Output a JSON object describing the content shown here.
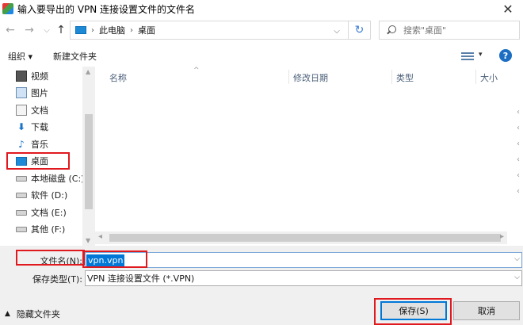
{
  "window": {
    "title": "输入要导出的 VPN 连接设置文件的文件名",
    "close_glyph": "✕"
  },
  "nav": {
    "back_glyph": "←",
    "forward_glyph": "→",
    "recent_glyph": "⌵",
    "up_glyph": "↑",
    "breadcrumb": [
      "此电脑",
      "桌面"
    ],
    "refresh_glyph": "↻",
    "search_placeholder": "搜索\"桌面\""
  },
  "toolbar": {
    "organize_label": "组织 ▾",
    "new_folder_label": "新建文件夹",
    "help_glyph": "?"
  },
  "sidebar": {
    "items": [
      {
        "label": "视频",
        "icon": "video-icon"
      },
      {
        "label": "图片",
        "icon": "pictures-icon"
      },
      {
        "label": "文档",
        "icon": "documents-icon"
      },
      {
        "label": "下载",
        "icon": "download-icon",
        "glyph": "⬇"
      },
      {
        "label": "音乐",
        "icon": "music-icon",
        "glyph": "♪"
      },
      {
        "label": "桌面",
        "icon": "desktop-icon"
      },
      {
        "label": "本地磁盘 (C:)",
        "icon": "drive-c-icon"
      },
      {
        "label": "软件 (D:)",
        "icon": "drive-icon"
      },
      {
        "label": "文档 (E:)",
        "icon": "drive-icon"
      },
      {
        "label": "其他 (F:)",
        "icon": "drive-icon"
      }
    ]
  },
  "filelist": {
    "columns": [
      "名称",
      "修改日期",
      "类型",
      "大小"
    ]
  },
  "form": {
    "filename_label": "文件名(N):",
    "filename_value": "vpn.vpn",
    "filetype_label": "保存类型(T):",
    "filetype_value": "VPN 连接设置文件 (*.VPN)",
    "hide_folders_label": "隐藏文件夹",
    "save_label": "保存(S)",
    "cancel_label": "取消"
  },
  "accent_color": "#0078d7",
  "annotation_color": "#e0191f"
}
